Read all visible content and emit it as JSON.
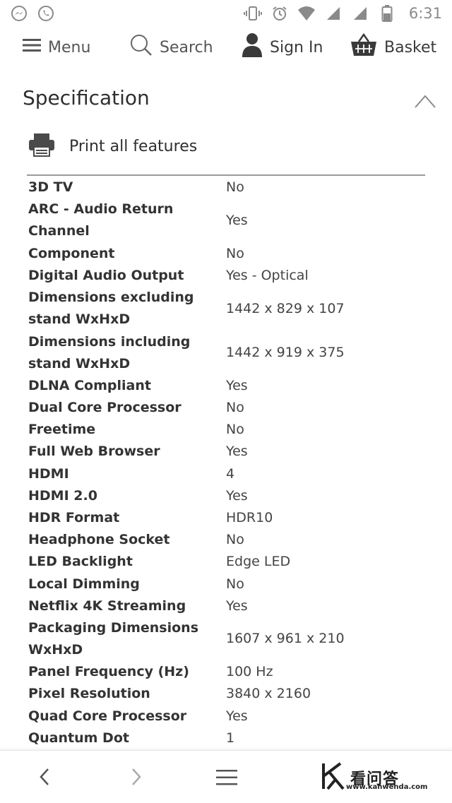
{
  "status_bar": {
    "time": "6:31",
    "left_icons": [
      "messenger-icon",
      "whatsapp-icon"
    ],
    "right_icons": [
      "vibrate-icon",
      "alarm-icon",
      "wifi-icon",
      "signal-icon",
      "signal-r-icon",
      "battery-icon"
    ]
  },
  "nav": {
    "menu_label": "Menu",
    "search_label": "Search",
    "signin_label": "Sign In",
    "basket_label": "Basket"
  },
  "section": {
    "title": "Specification",
    "print_label": "Print all features"
  },
  "specs": [
    {
      "label": "3D TV",
      "value": "No"
    },
    {
      "label": "ARC - Audio Return Channel",
      "value": "Yes"
    },
    {
      "label": "Component",
      "value": "No"
    },
    {
      "label": "Digital Audio Output",
      "value": "Yes - Optical"
    },
    {
      "label": "Dimensions excluding stand WxHxD",
      "value": "1442 x 829 x 107"
    },
    {
      "label": "Dimensions including stand WxHxD",
      "value": "1442 x 919 x 375"
    },
    {
      "label": "DLNA Compliant",
      "value": "Yes"
    },
    {
      "label": "Dual Core Processor",
      "value": "No"
    },
    {
      "label": "Freetime",
      "value": "No"
    },
    {
      "label": "Full Web Browser",
      "value": "Yes"
    },
    {
      "label": "HDMI",
      "value": "4"
    },
    {
      "label": "HDMI 2.0",
      "value": "Yes"
    },
    {
      "label": "HDR Format",
      "value": "HDR10"
    },
    {
      "label": "Headphone Socket",
      "value": "No"
    },
    {
      "label": "LED Backlight",
      "value": "Edge LED"
    },
    {
      "label": "Local Dimming",
      "value": "No"
    },
    {
      "label": "Netflix 4K Streaming",
      "value": "Yes"
    },
    {
      "label": "Packaging Dimensions WxHxD",
      "value": "1607 x 961 x 210"
    },
    {
      "label": "Panel Frequency (Hz)",
      "value": "100 Hz"
    },
    {
      "label": "Pixel Resolution",
      "value": "3840 x 2160"
    },
    {
      "label": "Quad Core Processor",
      "value": "Yes"
    },
    {
      "label": "Quantum Dot",
      "value": "1"
    }
  ],
  "bottom_bar": {
    "watermark_text": "看问答",
    "watermark_url": "www.kanwenda.com"
  }
}
